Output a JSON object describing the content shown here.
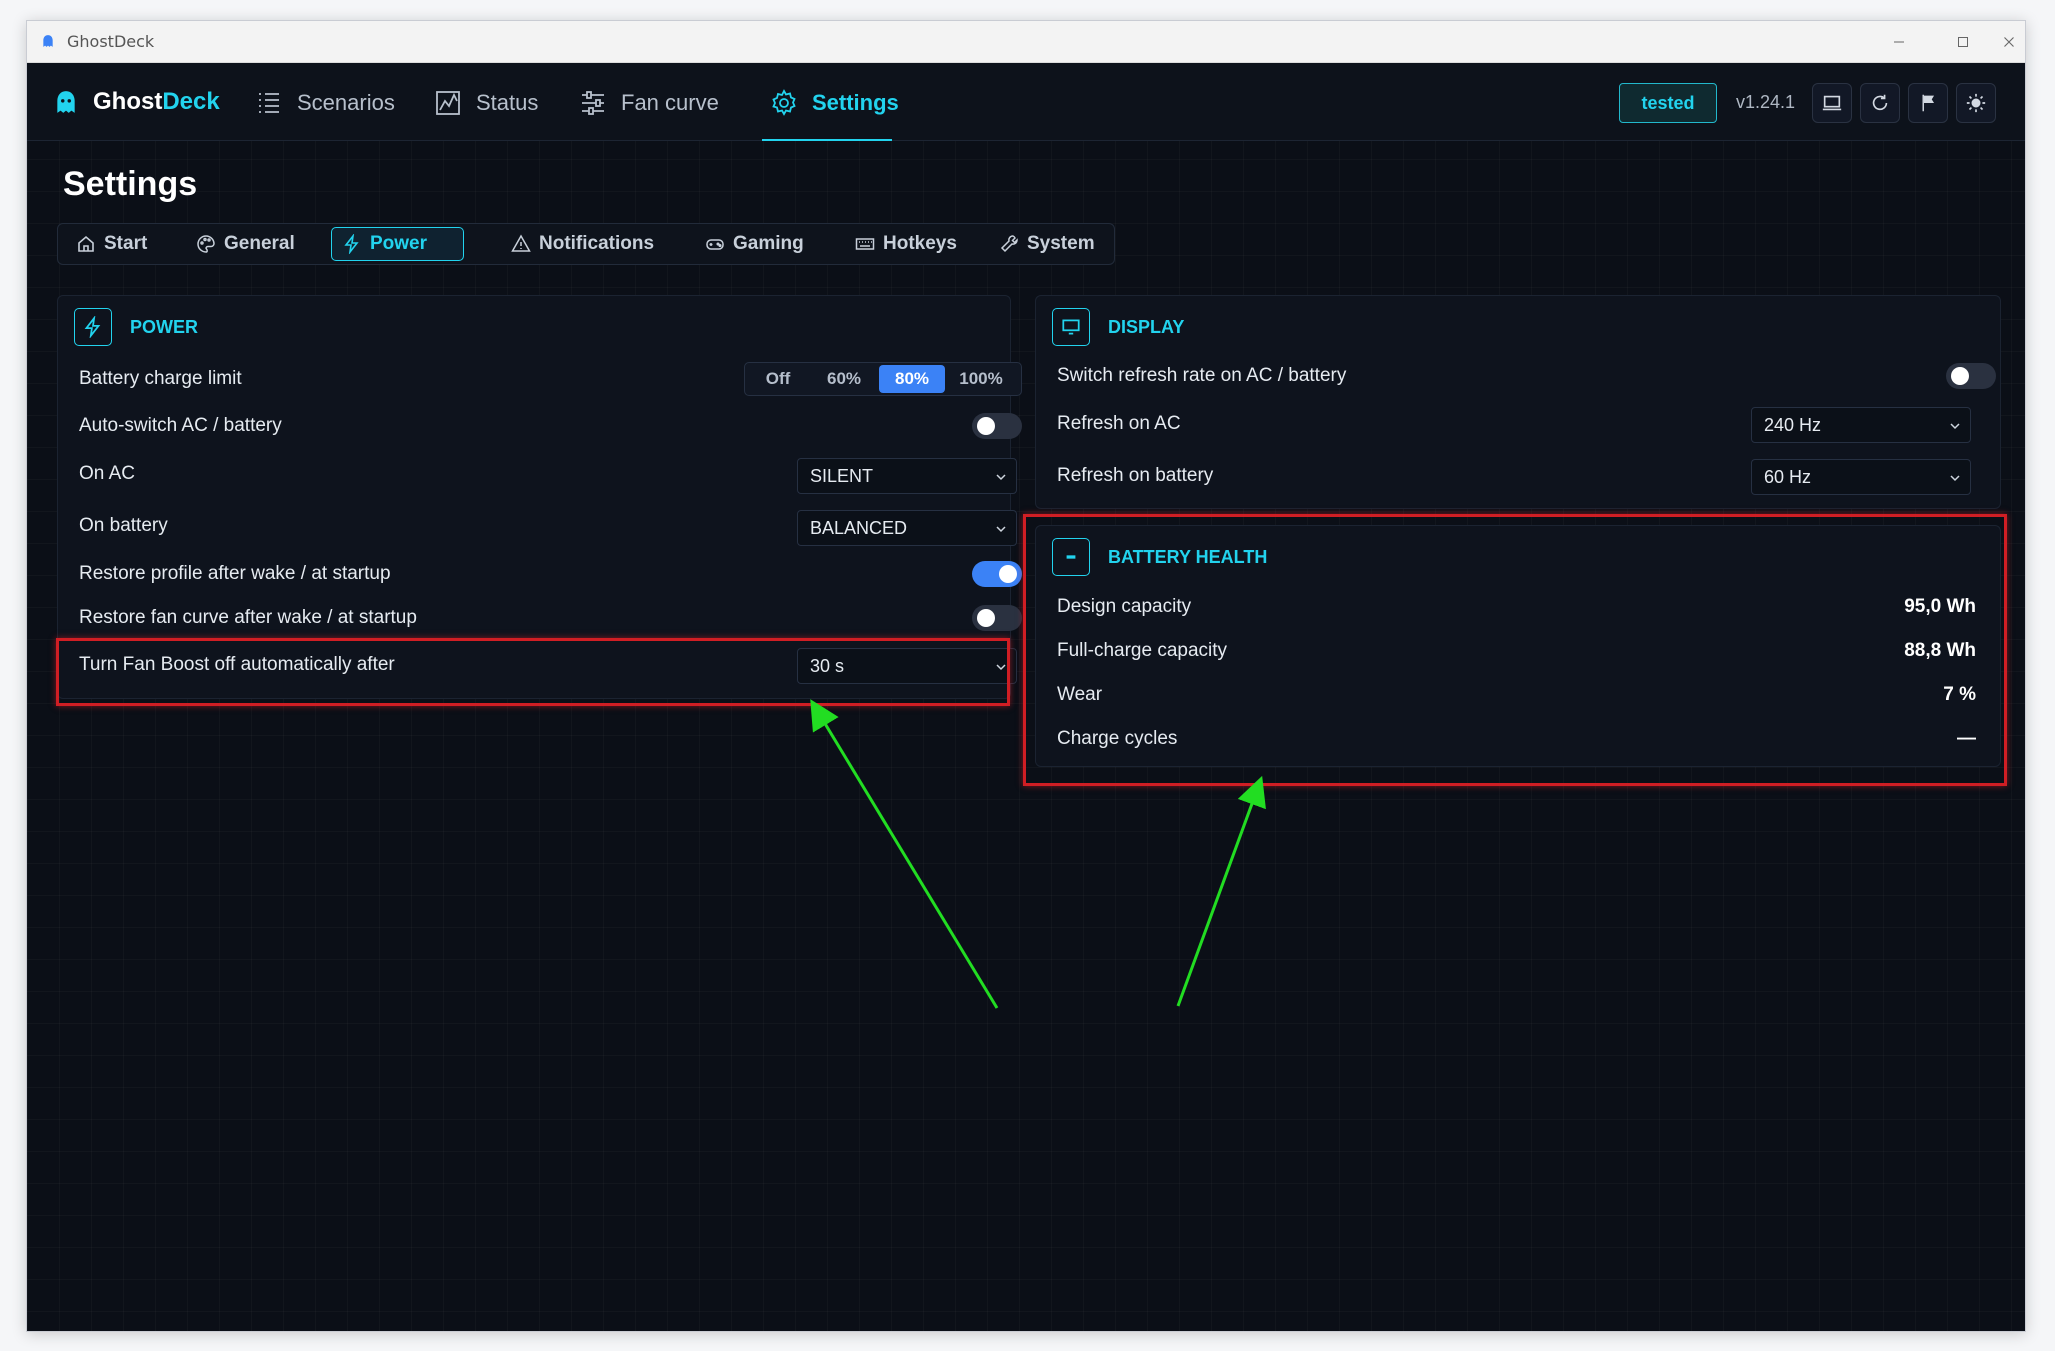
{
  "window": {
    "title": "GhostDeck"
  },
  "brand": {
    "name_part1": "Ghost",
    "name_part2": "Deck"
  },
  "nav": [
    {
      "label": "Scenarios",
      "icon": "list-icon"
    },
    {
      "label": "Status",
      "icon": "chart-icon"
    },
    {
      "label": "Fan curve",
      "icon": "sliders-icon"
    },
    {
      "label": "Settings",
      "icon": "gear-icon",
      "active": true
    }
  ],
  "header": {
    "badge": "tested",
    "version": "v1.24.1",
    "buttons": [
      "laptop-icon",
      "refresh-icon",
      "flag-icon",
      "sun-icon"
    ]
  },
  "page": {
    "title": "Settings"
  },
  "tabs": [
    {
      "label": "Start",
      "icon": "home-icon"
    },
    {
      "label": "General",
      "icon": "palette-icon"
    },
    {
      "label": "Power",
      "icon": "bolt-icon",
      "active": true
    },
    {
      "label": "Notifications",
      "icon": "warning-icon"
    },
    {
      "label": "Gaming",
      "icon": "gamepad-icon"
    },
    {
      "label": "Hotkeys",
      "icon": "keyboard-icon"
    },
    {
      "label": "System",
      "icon": "wrench-icon"
    }
  ],
  "power": {
    "title": "POWER",
    "charge_limit": {
      "label": "Battery charge limit",
      "options": [
        "Off",
        "60%",
        "80%",
        "100%"
      ],
      "selected": "80%"
    },
    "auto_switch": {
      "label": "Auto-switch AC / battery",
      "on": false
    },
    "on_ac": {
      "label": "On AC",
      "value": "SILENT"
    },
    "on_battery": {
      "label": "On battery",
      "value": "BALANCED"
    },
    "restore_profile": {
      "label": "Restore profile after wake / at startup",
      "on": true
    },
    "restore_fan": {
      "label": "Restore fan curve after wake / at startup",
      "on": false
    },
    "fan_boost": {
      "label": "Turn Fan Boost off automatically after",
      "value": "30 s"
    }
  },
  "display": {
    "title": "DISPLAY",
    "switch_refresh": {
      "label": "Switch refresh rate on AC / battery",
      "on": false
    },
    "refresh_ac": {
      "label": "Refresh on AC",
      "value": "240 Hz"
    },
    "refresh_battery": {
      "label": "Refresh on battery",
      "value": "60 Hz"
    }
  },
  "battery": {
    "title": "BATTERY HEALTH",
    "design": {
      "label": "Design capacity",
      "value": "95,0 Wh"
    },
    "full": {
      "label": "Full-charge capacity",
      "value": "88,8 Wh"
    },
    "wear": {
      "label": "Wear",
      "value": "7 %"
    },
    "cycles": {
      "label": "Charge cycles",
      "value": "—"
    }
  },
  "colors": {
    "accent": "#22d3ee",
    "toggle_on": "#3b82f6",
    "highlight": "#d01e24",
    "arrow": "#22dd22"
  }
}
